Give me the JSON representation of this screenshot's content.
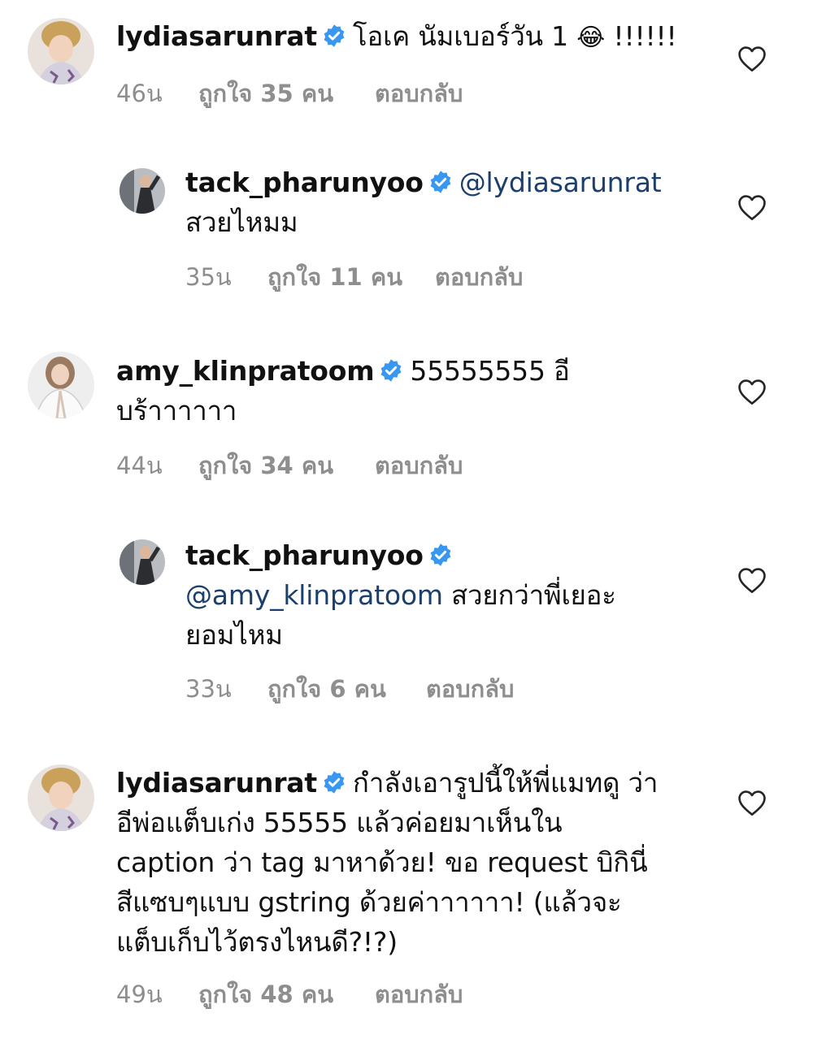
{
  "verified_color": "#3897f0",
  "icons": {
    "verified": "verified-badge-icon",
    "like": "heart-outline-icon"
  },
  "comments": [
    {
      "username": "lydiasarunrat",
      "mention": "",
      "text": "โอเค นัมเบอร์วัน 1",
      "emoji": "😂",
      "tail": " !!!!!!",
      "time": "46น",
      "likes": "ถูกใจ 35 คน",
      "reply": "ตอบกลับ"
    },
    {
      "username": "tack_pharunyoo",
      "mention": "@lydiasarunrat",
      "text": "สวยไหมม",
      "time": "35น",
      "likes": "ถูกใจ 11 คน",
      "reply": "ตอบกลับ"
    },
    {
      "username": "amy_klinpratoom",
      "mention": "",
      "text": "55555555 อี",
      "text2": "บร้าาาาาา",
      "time": "44น",
      "likes": "ถูกใจ 34 คน",
      "reply": "ตอบกลับ"
    },
    {
      "username": "tack_pharunyoo",
      "mention": "@amy_klinpratoom",
      "text": " สวยกว่าพี่เยอะ",
      "text2": "ยอมไหม",
      "time": "33น",
      "likes": "ถูกใจ 6 คน",
      "reply": "ตอบกลับ"
    },
    {
      "username": "lydiasarunrat",
      "mention": "",
      "text": "กำลังเอารูปนี้ให้พี่แมทดู ว่า",
      "text2": "อีพ่อแต็บเก่ง 55555 แล้วค่อยมาเห็นใน",
      "text3": "caption ว่า tag มาหาด้วย! ขอ request บิกินี่",
      "text4": "สีแซบๆแบบ gstring ด้วยค่าาาาาา! (แล้วจะ",
      "text5": "แต็บเก็บไว้ตรงไหนดี?!?)",
      "time": "49น",
      "likes": "ถูกใจ 48 คน",
      "reply": "ตอบกลับ"
    }
  ]
}
